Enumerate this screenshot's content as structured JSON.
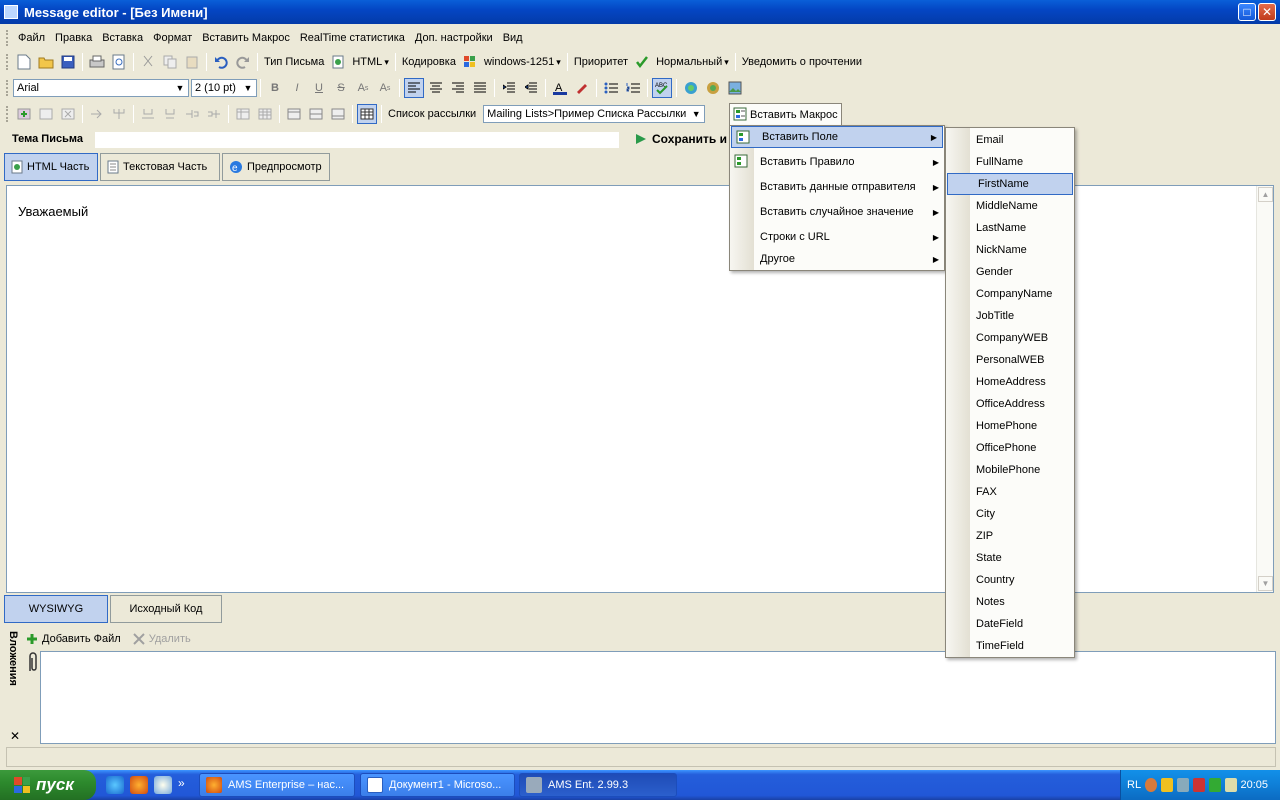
{
  "window": {
    "title": "Message editor - [Без Имени]"
  },
  "menubar": [
    "Файл",
    "Правка",
    "Вставка",
    "Формат",
    "Вставить Макрос",
    "RealTime статистика",
    "Доп. настройки",
    "Вид"
  ],
  "toolbar1": {
    "type_label": "Тип Письма",
    "html_label": "HTML",
    "encoding_label": "Кодировка",
    "charset_label": "windows-1251",
    "priority_label": "Приоритет",
    "priority_value": "Нормальный",
    "notify_label": "Уведомить о прочтении"
  },
  "toolbar2": {
    "font_value": "Arial",
    "size_value": "2  (10 pt)"
  },
  "toolbar3": {
    "list_label": "Список рассылки",
    "list_value": "Mailing Lists>Пример Списка Рассылки"
  },
  "subject": {
    "label": "Тема Письма",
    "value": "",
    "save_label": "Сохранить и"
  },
  "tabs": [
    "HTML Часть",
    "Текстовая Часть",
    "Предпросмотр"
  ],
  "editor": {
    "text": "Уважаемый"
  },
  "bottom_tabs": [
    "WYSIWYG",
    "Исходный Код"
  ],
  "attachments": {
    "side_label": "Вложения",
    "add_label": "Добавить Файл",
    "delete_label": "Удалить",
    "close_glyph": "✕"
  },
  "macro_menu": {
    "header": "Вставить Макрос",
    "items": [
      {
        "label": "Вставить Поле"
      },
      {
        "label": "Вставить Правило"
      },
      {
        "label": "Вставить данные отправителя"
      },
      {
        "label": "Вставить случайное значение"
      },
      {
        "label": "Строки с URL"
      },
      {
        "label": "Другое"
      }
    ]
  },
  "field_menu": {
    "selected": "FirstName",
    "items": [
      "Email",
      "FullName",
      "FirstName",
      "MiddleName",
      "LastName",
      "NickName",
      "Gender",
      "CompanyName",
      "JobTitle",
      "CompanyWEB",
      "PersonalWEB",
      "HomeAddress",
      "OfficeAddress",
      "HomePhone",
      "OfficePhone",
      "MobilePhone",
      "FAX",
      "City",
      "ZIP",
      "State",
      "Country",
      "Notes",
      "DateField",
      "TimeField"
    ]
  },
  "taskbar": {
    "start_label": "пуск",
    "quicklaunch_more": "»",
    "tasks": [
      "AMS Enterprise – нас...",
      "Документ1 - Microso...",
      "AMS Ent. 2.99.3"
    ],
    "lang": "RL",
    "clock": "20:05"
  },
  "colors": {
    "accent": "#316ac5",
    "highlight": "#c1d2ee",
    "titlebar": "#0446c4",
    "taskbar": "#245edb"
  }
}
